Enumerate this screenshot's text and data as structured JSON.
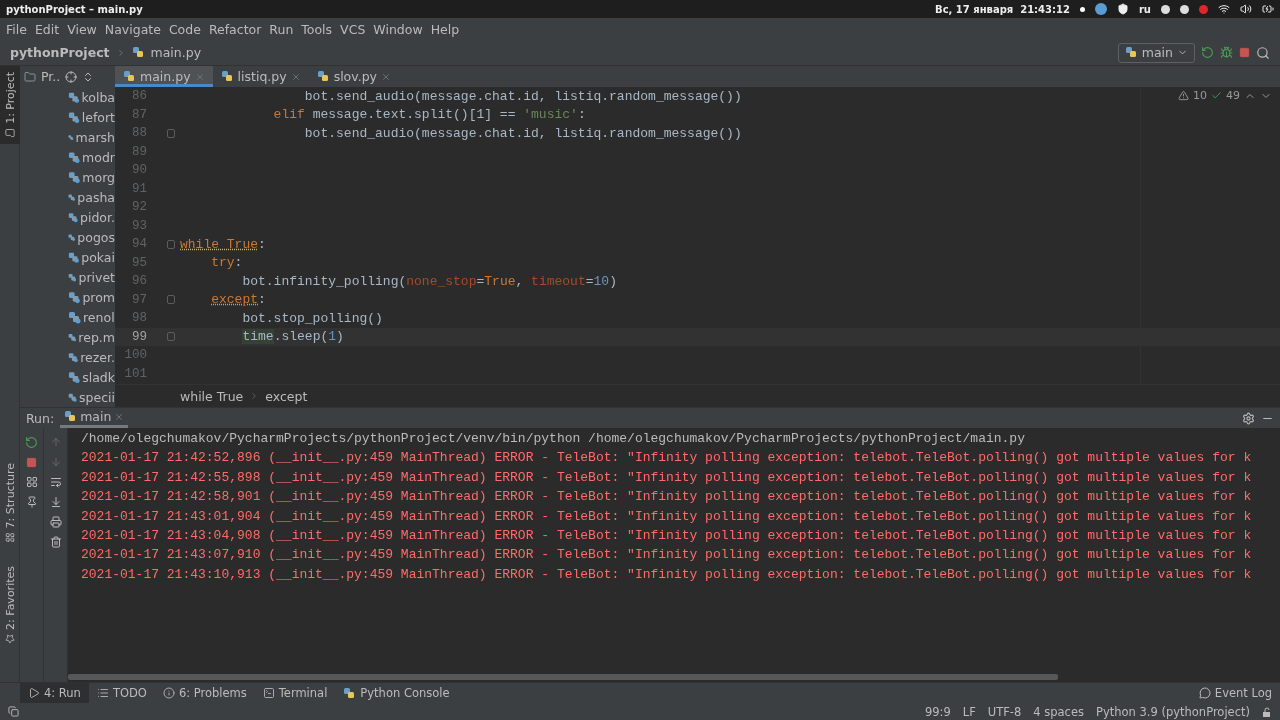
{
  "system_bar": {
    "title": "pythonProject – main.py",
    "datetime": "Вс, 17 января  21:43:12",
    "keyboard_layout": "ru"
  },
  "menu": [
    "File",
    "Edit",
    "View",
    "Navigate",
    "Code",
    "Refactor",
    "Run",
    "Tools",
    "VCS",
    "Window",
    "Help"
  ],
  "nav": {
    "project": "pythonProject",
    "file": "main.py",
    "run_config": "main"
  },
  "side_tabs": [
    {
      "label": "1: Project",
      "selected": true
    },
    {
      "label": "7: Structure",
      "selected": false
    },
    {
      "label": "2: Favorites",
      "selected": false
    }
  ],
  "project_panel": {
    "title": "Pr..",
    "items": [
      "kolba",
      "lefort",
      "marsh",
      "modr",
      "morg",
      "pasha",
      "pidor.",
      "pogos",
      "pokai",
      "privet",
      "prom",
      "renol",
      "rep.m",
      "rezer.",
      "sladk",
      "specii"
    ]
  },
  "editor": {
    "tabs": [
      {
        "label": "main.py",
        "selected": true
      },
      {
        "label": "listiq.py",
        "selected": false
      },
      {
        "label": "slov.py",
        "selected": false
      }
    ],
    "warnings": "10",
    "checks": "49",
    "lines": [
      {
        "number": "86",
        "current": false,
        "fold": false,
        "tokens": [
          {
            "kind": "plain",
            "text": "                bot.send_audio(message.chat.id, listiq.random_message())"
          }
        ]
      },
      {
        "number": "87",
        "current": false,
        "fold": false,
        "tokens": [
          {
            "kind": "keyword",
            "text": "            elif"
          },
          {
            "kind": "plain",
            "text": " message.text.split()[1] == "
          },
          {
            "kind": "string",
            "text": "'music'"
          },
          {
            "kind": "plain",
            "text": ":"
          }
        ]
      },
      {
        "number": "88",
        "current": false,
        "fold": true,
        "tokens": [
          {
            "kind": "plain",
            "text": "                bot.send_audio(message.chat.id, listiq.random_message())"
          }
        ]
      },
      {
        "number": "89",
        "current": false,
        "fold": false
      },
      {
        "number": "90",
        "current": false,
        "fold": false
      },
      {
        "number": "91",
        "current": false,
        "fold": false
      },
      {
        "number": "92",
        "current": false,
        "fold": false
      },
      {
        "number": "93",
        "current": false,
        "fold": false
      },
      {
        "number": "94",
        "current": false,
        "fold": true,
        "tokens": [
          {
            "kind": "warn_keyword",
            "text": "while True"
          },
          {
            "kind": "plain",
            "text": ":"
          }
        ]
      },
      {
        "number": "95",
        "current": false,
        "fold": false,
        "tokens": [
          {
            "kind": "keyword",
            "text": "    try"
          },
          {
            "kind": "plain",
            "text": ":"
          }
        ]
      },
      {
        "number": "96",
        "current": false,
        "fold": false,
        "tokens": [
          {
            "kind": "plain",
            "text": "        bot.infinity_polling("
          },
          {
            "kind": "param",
            "text": "none_stop"
          },
          {
            "kind": "plain",
            "text": "="
          },
          {
            "kind": "keyword",
            "text": "True"
          },
          {
            "kind": "plain",
            "text": ", "
          },
          {
            "kind": "param",
            "text": "timeout"
          },
          {
            "kind": "plain",
            "text": "="
          },
          {
            "kind": "number",
            "text": "10"
          },
          {
            "kind": "plain",
            "text": ")"
          }
        ]
      },
      {
        "number": "97",
        "current": false,
        "fold": true,
        "tokens": [
          {
            "kind": "warn_keyword",
            "text": "    except"
          },
          {
            "kind": "plain",
            "text": ":"
          }
        ]
      },
      {
        "number": "98",
        "current": false,
        "fold": false,
        "tokens": [
          {
            "kind": "plain",
            "text": "        bot.stop_polling()"
          }
        ]
      },
      {
        "number": "99",
        "current": true,
        "fold": true,
        "tokens": [
          {
            "kind": "highlight",
            "text": "        time"
          },
          {
            "kind": "plain",
            "text": ".sleep("
          },
          {
            "kind": "number",
            "text": "1"
          },
          {
            "kind": "plain",
            "text": ")"
          }
        ]
      },
      {
        "number": "100",
        "current": false,
        "fold": false
      },
      {
        "number": "101",
        "current": false,
        "fold": false
      }
    ],
    "breadcrumbs": [
      "while True",
      "except"
    ]
  },
  "run": {
    "label": "Run:",
    "tabs": [
      {
        "label": "main",
        "selected": true
      }
    ],
    "console": [
      {
        "kind": "command",
        "text": "/home/olegchumakov/PycharmProjects/pythonProject/venv/bin/python /home/olegchumakov/PycharmProjects/pythonProject/main.py"
      },
      {
        "kind": "error",
        "text": "2021-01-17 21:42:52,896 (__init__.py:459 MainThread) ERROR - TeleBot: \"Infinity polling exception: telebot.TeleBot.polling() got multiple values for k"
      },
      {
        "kind": "error",
        "text": "2021-01-17 21:42:55,898 (__init__.py:459 MainThread) ERROR - TeleBot: \"Infinity polling exception: telebot.TeleBot.polling() got multiple values for k"
      },
      {
        "kind": "error",
        "text": "2021-01-17 21:42:58,901 (__init__.py:459 MainThread) ERROR - TeleBot: \"Infinity polling exception: telebot.TeleBot.polling() got multiple values for k"
      },
      {
        "kind": "error",
        "text": "2021-01-17 21:43:01,904 (__init__.py:459 MainThread) ERROR - TeleBot: \"Infinity polling exception: telebot.TeleBot.polling() got multiple values for k"
      },
      {
        "kind": "error",
        "text": "2021-01-17 21:43:04,908 (__init__.py:459 MainThread) ERROR - TeleBot: \"Infinity polling exception: telebot.TeleBot.polling() got multiple values for k"
      },
      {
        "kind": "error",
        "text": "2021-01-17 21:43:07,910 (__init__.py:459 MainThread) ERROR - TeleBot: \"Infinity polling exception: telebot.TeleBot.polling() got multiple values for k"
      },
      {
        "kind": "error",
        "text": "2021-01-17 21:43:10,913 (__init__.py:459 MainThread) ERROR - TeleBot: \"Infinity polling exception: telebot.TeleBot.polling() got multiple values for k"
      }
    ]
  },
  "tool_tabs": [
    {
      "kind": "run",
      "label": "4: Run",
      "selected": true
    },
    {
      "kind": "todo",
      "label": "TODO",
      "selected": false
    },
    {
      "kind": "problems",
      "label": "6: Problems",
      "selected": false
    },
    {
      "kind": "terminal",
      "label": "Terminal",
      "selected": false
    },
    {
      "kind": "console",
      "label": "Python Console",
      "selected": false
    }
  ],
  "event_log": "Event Log",
  "status_bar": [
    "99:9",
    "LF",
    "UTF-8",
    "4 spaces",
    "Python 3.9 (pythonProject)"
  ]
}
